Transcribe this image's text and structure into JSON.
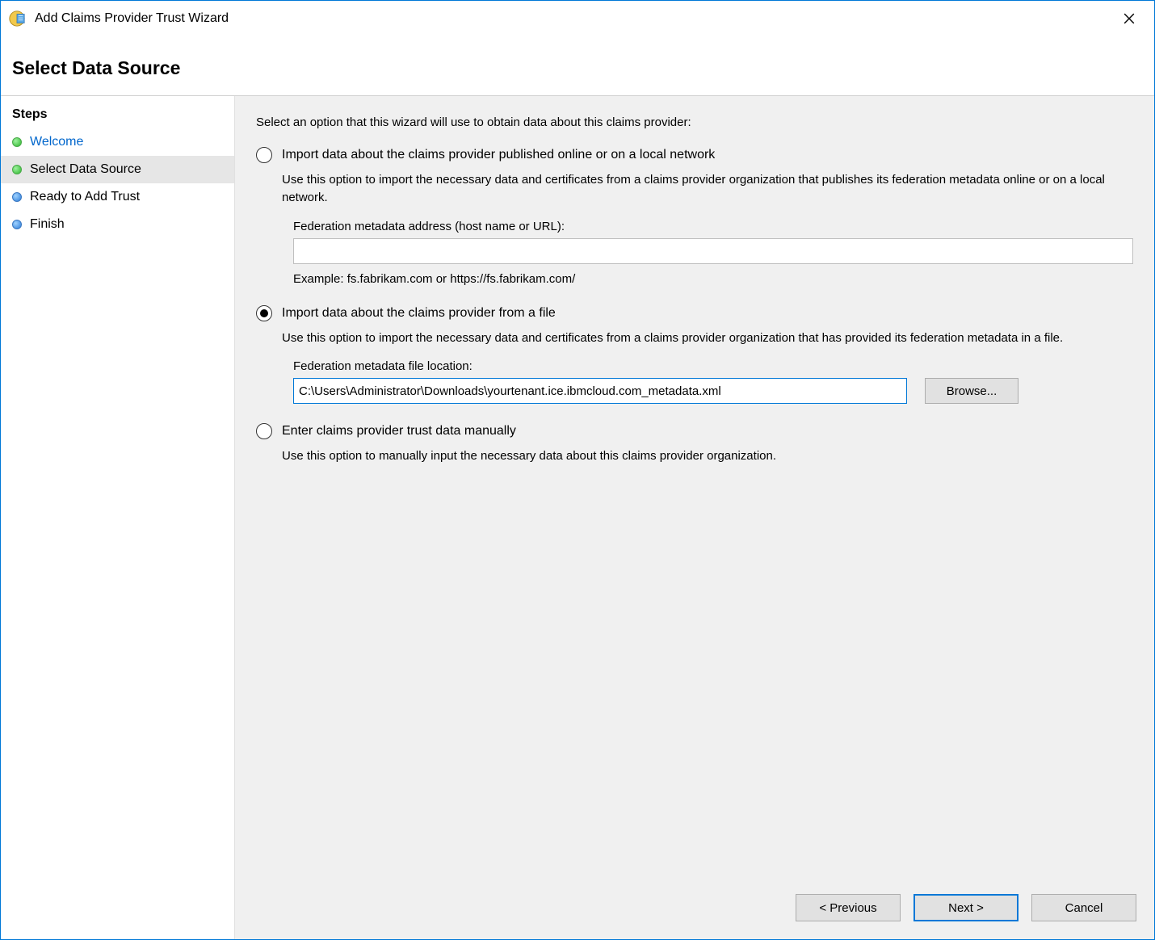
{
  "window": {
    "title": "Add Claims Provider Trust Wizard"
  },
  "header": {
    "title": "Select Data Source"
  },
  "sidebar": {
    "heading": "Steps",
    "items": [
      {
        "label": "Welcome",
        "bullet": "green",
        "link": true,
        "selected": false
      },
      {
        "label": "Select Data Source",
        "bullet": "green",
        "link": false,
        "selected": true
      },
      {
        "label": "Ready to Add Trust",
        "bullet": "blue",
        "link": false,
        "selected": false
      },
      {
        "label": "Finish",
        "bullet": "blue",
        "link": false,
        "selected": false
      }
    ]
  },
  "main": {
    "intro": "Select an option that this wizard will use to obtain data about this claims provider:",
    "options": {
      "online": {
        "label": "Import data about the claims provider published online or on a local network",
        "desc": "Use this option to import the necessary data and certificates from a claims provider organization that publishes its federation metadata online or on a local network.",
        "field_label": "Federation metadata address (host name or URL):",
        "value": "",
        "example": "Example: fs.fabrikam.com or https://fs.fabrikam.com/",
        "selected": false
      },
      "file": {
        "label": "Import data about the claims provider from a file",
        "desc": "Use this option to import the necessary data and certificates from a claims provider organization that has provided its federation metadata in a file.",
        "field_label": "Federation metadata file location:",
        "value": "C:\\Users\\Administrator\\Downloads\\yourtenant.ice.ibmcloud.com_metadata.xml",
        "browse_label": "Browse...",
        "selected": true
      },
      "manual": {
        "label": "Enter claims provider trust data manually",
        "desc": "Use this option to manually input the necessary data about this claims provider organization.",
        "selected": false
      }
    }
  },
  "buttons": {
    "previous": "< Previous",
    "next": "Next >",
    "cancel": "Cancel"
  }
}
